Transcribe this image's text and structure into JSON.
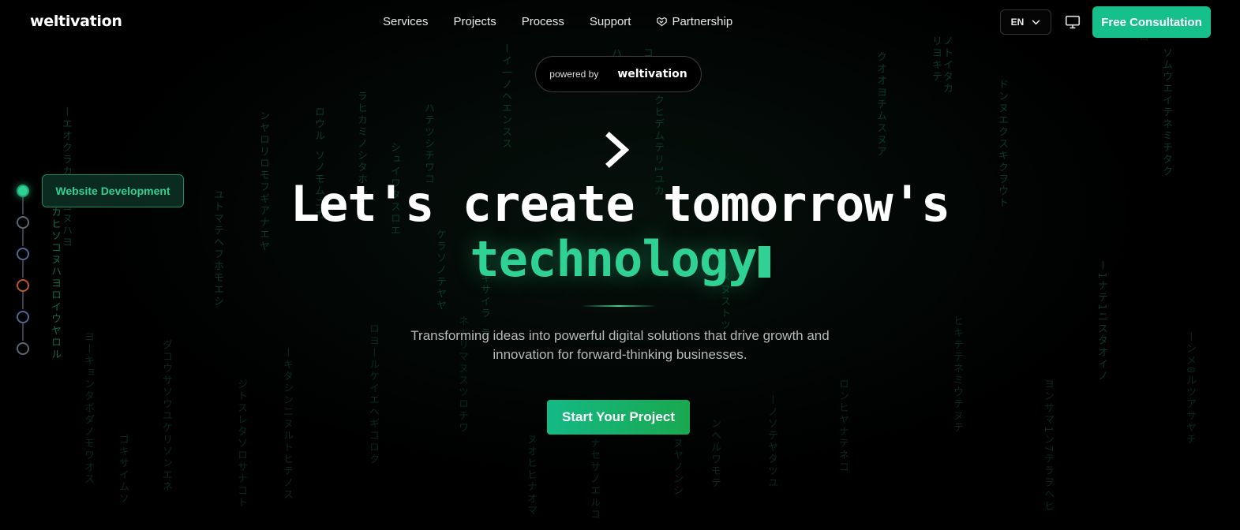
{
  "brand": {
    "name": "weltivation"
  },
  "nav": {
    "links": [
      {
        "label": "Services"
      },
      {
        "label": "Projects"
      },
      {
        "label": "Process"
      },
      {
        "label": "Support"
      },
      {
        "label": "Partnership",
        "icon": "handshake-icon"
      }
    ],
    "language": "EN",
    "theme_icon": "monitor-icon",
    "cta_label": "Free Consultation"
  },
  "badge": {
    "prefix": "powered by",
    "brand": "weltivation"
  },
  "hero": {
    "chevron_icon": "chevron-right-icon",
    "line1": "Let's create tomorrow's",
    "line2": "technology",
    "subtitle": "Transforming ideas into powerful digital solutions that drive growth and innovation for forward-thinking businesses.",
    "cta_label": "Start Your Project"
  },
  "stepper": {
    "active_label": "Website Development",
    "step_count": 6,
    "active_index": 0
  },
  "colors": {
    "accent": "#2fd293",
    "cta": "#16c08a",
    "background": "#000000",
    "rain": "#0f6b45"
  }
}
